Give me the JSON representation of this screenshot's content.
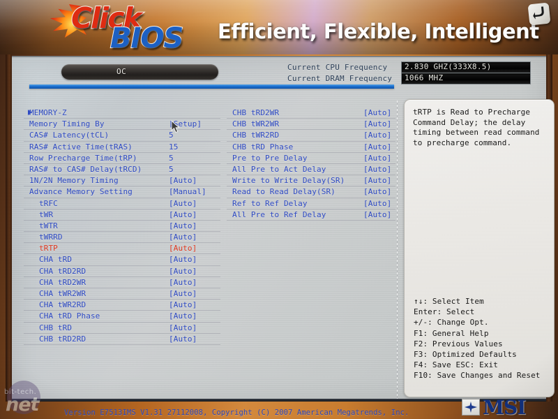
{
  "header": {
    "logo_click": "Click",
    "logo_bios": "BIOS",
    "tagline": "Efficient, Flexible, Intelligent",
    "return_icon": "return-arrow-icon"
  },
  "tabs": [
    {
      "label": "OC",
      "active": true
    }
  ],
  "status": {
    "rows": [
      {
        "label": "Current CPU Frequency",
        "value": "2.830 GHZ(333X8.5)"
      },
      {
        "label": "Current DRAM Frequency",
        "value": "1066 MHZ"
      }
    ]
  },
  "settings_left": [
    {
      "name": "MEMORY-Z",
      "value": "",
      "arrow": true,
      "selected": false
    },
    {
      "name": "Memory Timing By",
      "value": "[Setup]",
      "arrow": false,
      "selected": false
    },
    {
      "name": "CAS# Latency(tCL)",
      "value": "5",
      "arrow": false,
      "selected": false
    },
    {
      "name": "RAS# Active Time(tRAS)",
      "value": "15",
      "arrow": false,
      "selected": false
    },
    {
      "name": "Row Precharge Time(tRP)",
      "value": "5",
      "arrow": false,
      "selected": false
    },
    {
      "name": "RAS# to CAS# Delay(tRCD)",
      "value": "5",
      "arrow": false,
      "selected": false
    },
    {
      "name": "1N/2N Memory Timing",
      "value": "[Auto]",
      "arrow": false,
      "selected": false
    },
    {
      "name": "Advance Memory Setting",
      "value": "[Manual]",
      "arrow": false,
      "selected": false
    },
    {
      "name": "tRFC",
      "value": "[Auto]",
      "arrow": false,
      "selected": false,
      "sub": true
    },
    {
      "name": "tWR",
      "value": "[Auto]",
      "arrow": false,
      "selected": false,
      "sub": true
    },
    {
      "name": "tWTR",
      "value": "[Auto]",
      "arrow": false,
      "selected": false,
      "sub": true
    },
    {
      "name": "tWRRD",
      "value": "[Auto]",
      "arrow": false,
      "selected": false,
      "sub": true
    },
    {
      "name": "tRTP",
      "value": "[Auto]",
      "arrow": false,
      "selected": true,
      "sub": true
    },
    {
      "name": "CHA tRD",
      "value": "[Auto]",
      "arrow": false,
      "selected": false,
      "sub": true
    },
    {
      "name": "CHA tRD2RD",
      "value": "[Auto]",
      "arrow": false,
      "selected": false,
      "sub": true
    },
    {
      "name": "CHA tRD2WR",
      "value": "[Auto]",
      "arrow": false,
      "selected": false,
      "sub": true
    },
    {
      "name": "CHA tWR2WR",
      "value": "[Auto]",
      "arrow": false,
      "selected": false,
      "sub": true
    },
    {
      "name": "CHA tWR2RD",
      "value": "[Auto]",
      "arrow": false,
      "selected": false,
      "sub": true
    },
    {
      "name": "CHA tRD Phase",
      "value": "[Auto]",
      "arrow": false,
      "selected": false,
      "sub": true
    },
    {
      "name": "CHB tRD",
      "value": "[Auto]",
      "arrow": false,
      "selected": false,
      "sub": true
    },
    {
      "name": "CHB tRD2RD",
      "value": "[Auto]",
      "arrow": false,
      "selected": false,
      "sub": true
    }
  ],
  "settings_right": [
    {
      "name": "CHB tRD2WR",
      "value": "[Auto]"
    },
    {
      "name": "CHB tWR2WR",
      "value": "[Auto]"
    },
    {
      "name": "CHB tWR2RD",
      "value": "[Auto]"
    },
    {
      "name": "CHB tRD Phase",
      "value": "[Auto]"
    },
    {
      "name": "Pre to Pre Delay",
      "value": "[Auto]"
    },
    {
      "name": "All Pre to Act Delay",
      "value": "[Auto]"
    },
    {
      "name": "Write to Write Delay(SR)",
      "value": "[Auto]"
    },
    {
      "name": "Read to Read Delay(SR)",
      "value": "[Auto]"
    },
    {
      "name": "Ref to Ref Delay",
      "value": "[Auto]"
    },
    {
      "name": "All Pre to Ref Delay",
      "value": "[Auto]"
    }
  ],
  "help": {
    "description": "tRTP is Read to Precharge Command Delay; the delay timing between read command to precharge command.",
    "legend": [
      "↑↓: Select Item",
      "Enter: Select",
      "+/-: Change Opt.",
      "F1: General Help",
      "F2: Previous Values",
      "F3: Optimized Defaults",
      "F4: Save  ESC: Exit",
      "F10: Save Changes and Reset"
    ]
  },
  "footer": {
    "version": "Version E7513IMS V1.31 27112008, Copyright (C) 2007 American Megatrends, Inc.",
    "brand": "MSI",
    "watermark_top": "bit-tech.",
    "watermark_main": "net"
  },
  "colors": {
    "text_blue": "#2d49c4",
    "selected_red": "#e0361c",
    "accent_blue": "#1a6fd0",
    "panel_bg": "#c9cdcf",
    "header_orange": "#c4762a"
  }
}
